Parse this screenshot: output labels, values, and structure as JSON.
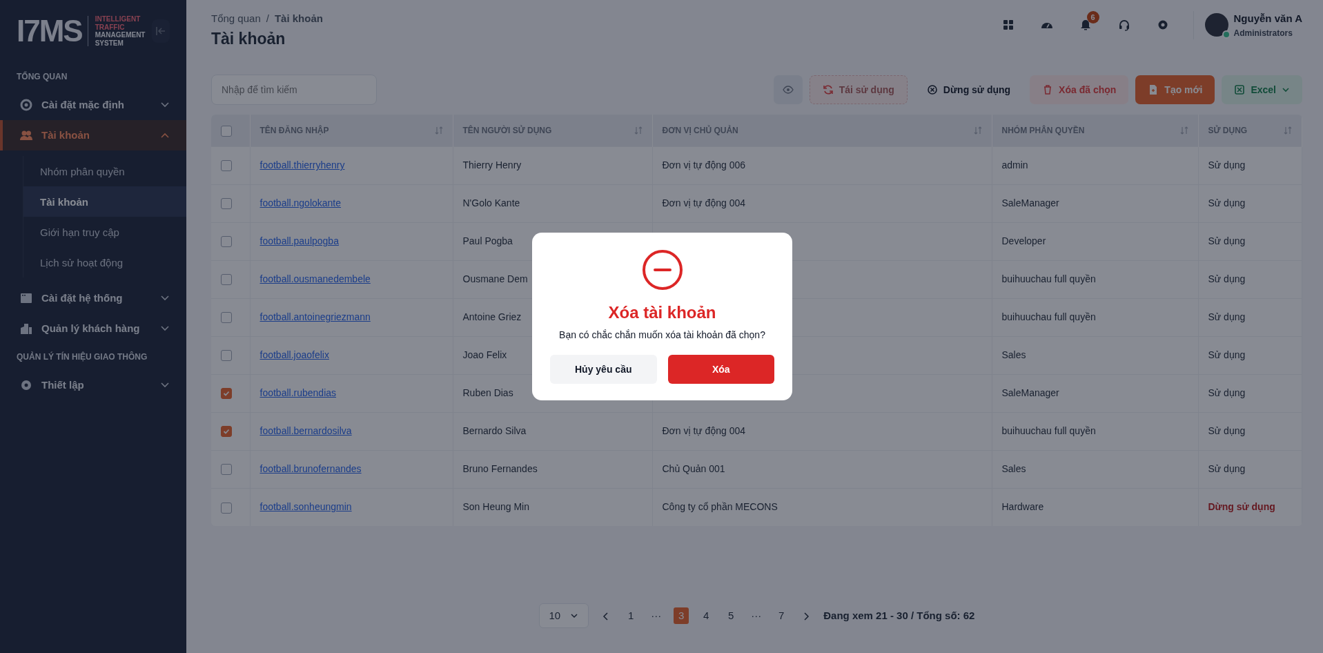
{
  "sidebar": {
    "logo": {
      "mark": "I7MS",
      "tagline_accent": "INTELLIGENT TRAFFIC",
      "tagline": "MANAGEMENT SYSTEM"
    },
    "sections": [
      {
        "label": "TỔNG QUAN",
        "items": [
          {
            "label": "Cài đặt mặc định",
            "expanded": false,
            "selected": false
          },
          {
            "label": "Tài khoản",
            "expanded": true,
            "selected": true,
            "children": [
              {
                "label": "Nhóm phân quyền",
                "selected": false
              },
              {
                "label": "Tài khoản",
                "selected": true
              },
              {
                "label": "Giới hạn truy cập",
                "selected": false
              },
              {
                "label": "Lịch sử hoạt động",
                "selected": false
              }
            ]
          },
          {
            "label": "Cài đặt hệ thống",
            "expanded": false,
            "selected": false
          },
          {
            "label": "Quản lý khách hàng",
            "expanded": false,
            "selected": false
          }
        ]
      },
      {
        "label": "QUẢN LÝ TÍN HIỆU GIAO THÔNG",
        "items": [
          {
            "label": "Thiết lập",
            "expanded": false,
            "selected": false
          }
        ]
      }
    ]
  },
  "header": {
    "breadcrumb": [
      "Tổng quan",
      "Tài khoản"
    ],
    "breadcrumb_separator": "/",
    "title": "Tài khoản",
    "notification_count": "6",
    "user": {
      "name": "Nguyễn văn A",
      "role": "Administrators",
      "online": true
    }
  },
  "toolbar": {
    "search": {
      "placeholder": "Nhập để tìm kiếm"
    },
    "buttons": [
      {
        "kind": "icon",
        "disabled": false
      },
      {
        "kind": "soft-danger",
        "label": "Tái sử dụng",
        "disabled": true
      },
      {
        "kind": "plain",
        "label": "Dừng sử dụng",
        "disabled": false
      },
      {
        "kind": "soft-danger",
        "label": "Xóa đã chọn",
        "disabled": false
      },
      {
        "kind": "primary",
        "label": "Tạo mới",
        "disabled": false
      },
      {
        "kind": "soft-success",
        "label": "Excel",
        "disabled": false
      }
    ]
  },
  "table": {
    "all_checked": false,
    "columns": [
      "TÊN ĐĂNG NHẬP",
      "TÊN NGƯỜI SỬ DỤNG",
      "ĐƠN VỊ CHỦ QUẢN",
      "NHÓM PHÂN QUYỀN",
      "SỬ DỤNG"
    ],
    "rows": [
      {
        "checked": false,
        "username": "football.thierryhenry",
        "name": "Thierry Henry",
        "unit": "Đơn vị tự động 006",
        "group": "admin",
        "status": "Sử dụng",
        "active": true
      },
      {
        "checked": false,
        "username": "football.ngolokante",
        "name": "N'Golo Kante",
        "unit": "Đơn vị tự động 004",
        "group": "SaleManager",
        "status": "Sử dụng",
        "active": true
      },
      {
        "checked": false,
        "username": "football.paulpogba",
        "name": "Paul Pogba",
        "group": "Developer",
        "status": "Sử dụng",
        "active": true
      },
      {
        "checked": false,
        "username": "football.ousmanedembele",
        "name": "Ousmane Dem",
        "group": "buihuuchau full quyền",
        "status": "Sử dụng",
        "active": true
      },
      {
        "checked": false,
        "username": "football.antoinegriezmann",
        "name": "Antoine Griez",
        "group": "buihuuchau full quyền",
        "status": "Sử dụng",
        "active": true
      },
      {
        "checked": false,
        "username": "football.joaofelix",
        "name": "Joao Felix",
        "group": "Sales",
        "status": "Sử dụng",
        "active": true
      },
      {
        "checked": true,
        "username": "football.rubendias",
        "name": "Ruben Dias",
        "group": "SaleManager",
        "status": "Sử dụng",
        "active": true
      },
      {
        "checked": true,
        "username": "football.bernardosilva",
        "name": "Bernardo Silva",
        "unit": "Đơn vị tự động 004",
        "group": "buihuuchau full quyền",
        "status": "Sử dụng",
        "active": true
      },
      {
        "checked": false,
        "username": "football.brunofernandes",
        "name": "Bruno Fernandes",
        "unit": "Chủ Quản 001",
        "group": "Sales",
        "status": "Sử dụng",
        "active": true
      },
      {
        "checked": false,
        "username": "football.sonheungmin",
        "name": "Son Heung Min",
        "unit": "Công ty cổ phần MECONS",
        "group": "Hardware",
        "status": "Dừng sử dụng",
        "active": false
      }
    ]
  },
  "pagination": {
    "page_size": "10",
    "pages": [
      {
        "label": "1",
        "selected": false
      },
      {
        "label": "···",
        "selected": false
      },
      {
        "label": "3",
        "selected": true
      },
      {
        "label": "4",
        "selected": false
      },
      {
        "label": "5",
        "selected": false
      },
      {
        "label": "···",
        "selected": false
      },
      {
        "label": "7",
        "selected": false
      }
    ],
    "summary": "Đang xem 21 - 30 / Tổng số: 62"
  },
  "dialog": {
    "title": "Xóa tài khoản",
    "message": "Bạn có chắc chắn muốn xóa tài khoản đã chọn?",
    "cancel": "Hủy yêu cầu",
    "confirm": "Xóa"
  }
}
